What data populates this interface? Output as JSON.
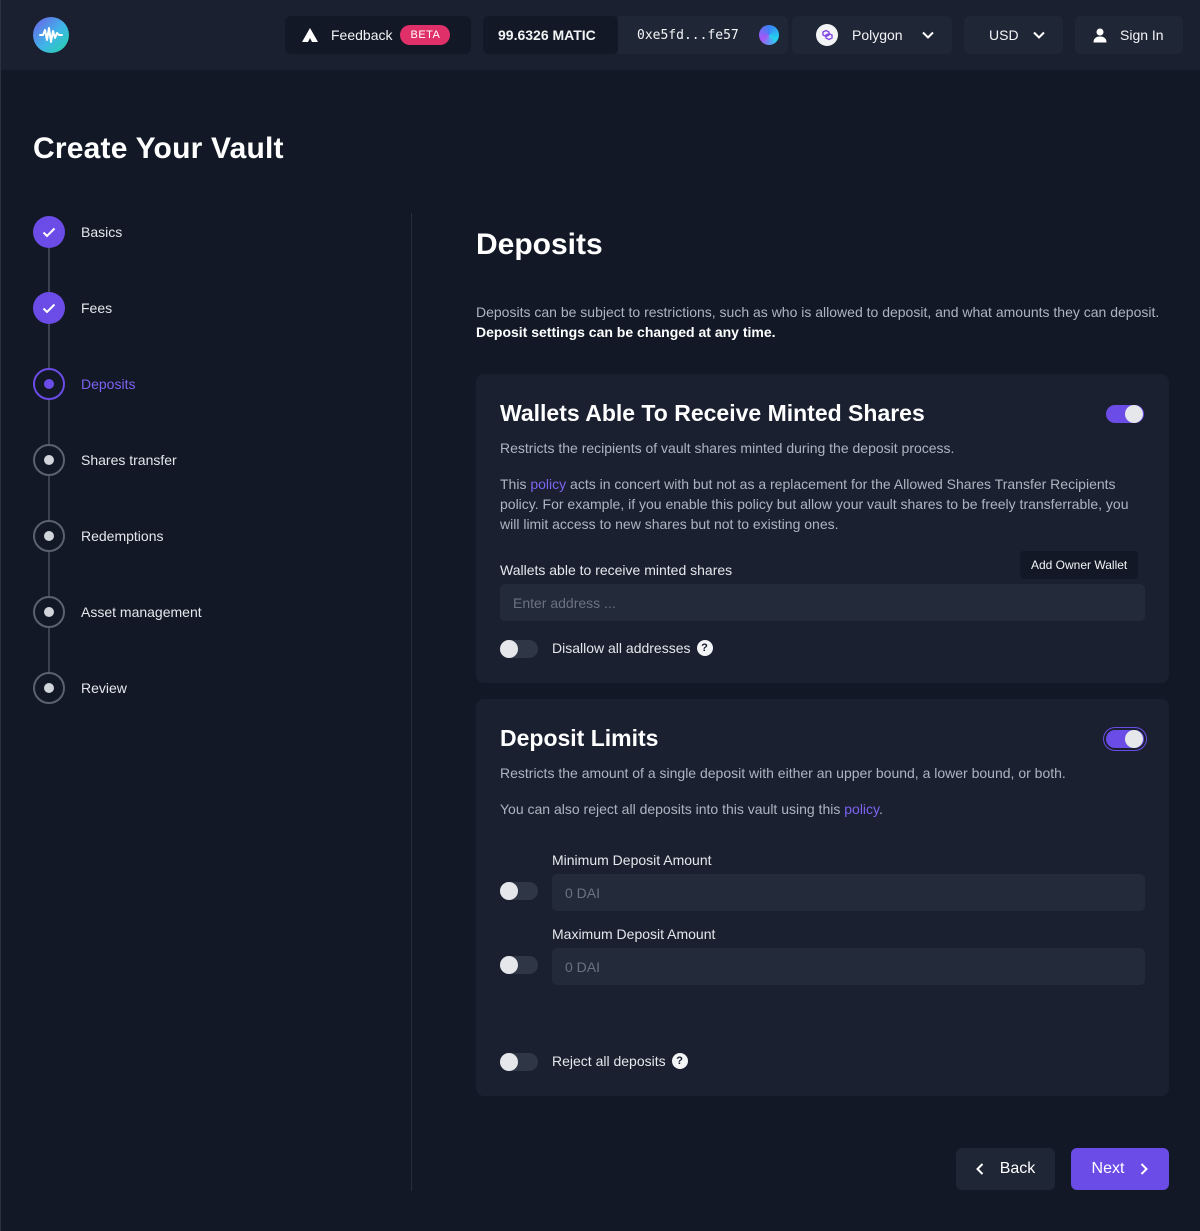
{
  "header": {
    "feedback_label": "Feedback",
    "beta_badge": "BETA",
    "balance": "99.6326 MATIC",
    "address": "0xe5fd...fe57",
    "network": "Polygon",
    "currency": "USD",
    "sign_in": "Sign In"
  },
  "page": {
    "title": "Create Your Vault"
  },
  "steps": [
    {
      "label": "Basics",
      "state": "done"
    },
    {
      "label": "Fees",
      "state": "done"
    },
    {
      "label": "Deposits",
      "state": "active"
    },
    {
      "label": "Shares transfer",
      "state": "todo"
    },
    {
      "label": "Redemptions",
      "state": "todo"
    },
    {
      "label": "Asset management",
      "state": "todo"
    },
    {
      "label": "Review",
      "state": "todo"
    }
  ],
  "main": {
    "title": "Deposits",
    "intro_text": "Deposits can be subject to restrictions, such as who is allowed to deposit, and what amounts they can deposit.",
    "intro_bold": "Deposit settings can be changed at any time."
  },
  "wallets_card": {
    "title": "Wallets Able To Receive Minted Shares",
    "enabled": true,
    "description": "Restricts the recipients of vault shares minted during the deposit process.",
    "policy_prefix": "This",
    "policy_link": "policy",
    "policy_suffix": "acts in concert with but not as a replacement for the Allowed Shares Transfer Recipients policy. For example, if you enable this policy but allow your vault shares to be freely transferrable, you will limit access to new shares but not to existing ones.",
    "field_label": "Wallets able to receive minted shares",
    "add_owner_button": "Add Owner Wallet",
    "address_placeholder": "Enter address ...",
    "disallow_label": "Disallow all addresses",
    "disallow_enabled": false
  },
  "limits_card": {
    "title": "Deposit Limits",
    "enabled": true,
    "description": "Restricts the amount of a single deposit with either an upper bound, a lower bound, or both.",
    "reject_prefix": "You can also reject all deposits into this vault using this",
    "reject_link": "policy",
    "reject_suffix": ".",
    "min_label": "Minimum Deposit Amount",
    "min_placeholder": "0 DAI",
    "min_enabled": false,
    "max_label": "Maximum Deposit Amount",
    "max_placeholder": "0 DAI",
    "max_enabled": false,
    "reject_all_label": "Reject all deposits",
    "reject_all_enabled": false
  },
  "footer": {
    "back_label": "Back",
    "next_label": "Next"
  },
  "colors": {
    "accent": "#6b4ce6",
    "background": "#121826",
    "card": "#1a2030",
    "beta": "#e0306a"
  }
}
